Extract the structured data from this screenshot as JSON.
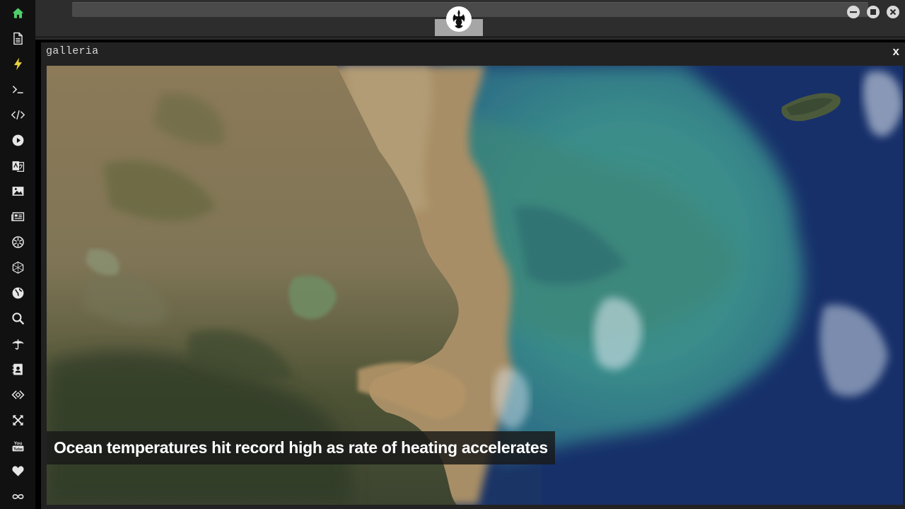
{
  "window": {
    "title": "galleria",
    "close_label": "x"
  },
  "gallery": {
    "caption": "Ocean temperatures hit record high as rate of heating accelerates"
  },
  "sidebar": {
    "items": [
      {
        "icon": "home-icon"
      },
      {
        "icon": "document-icon"
      },
      {
        "icon": "lightning-icon"
      },
      {
        "icon": "terminal-icon"
      },
      {
        "icon": "code-icon"
      },
      {
        "icon": "play-icon"
      },
      {
        "icon": "translate-icon"
      },
      {
        "icon": "image-icon"
      },
      {
        "icon": "newspaper-icon"
      },
      {
        "icon": "aperture-icon"
      },
      {
        "icon": "hexagon-icon"
      },
      {
        "icon": "globe-icon"
      },
      {
        "icon": "search-icon"
      },
      {
        "icon": "umbrella-icon"
      },
      {
        "icon": "address-book-icon"
      },
      {
        "icon": "code-diamond-icon"
      },
      {
        "icon": "expand-icon"
      },
      {
        "icon": "youtube-icon"
      },
      {
        "icon": "heart-icon"
      },
      {
        "icon": "infinity-icon"
      }
    ]
  },
  "colors": {
    "home_active": "#4fcf6a",
    "lightning_active": "#e8d13a",
    "sidebar_bg": "#111111",
    "icon": "#e6e6e6"
  }
}
